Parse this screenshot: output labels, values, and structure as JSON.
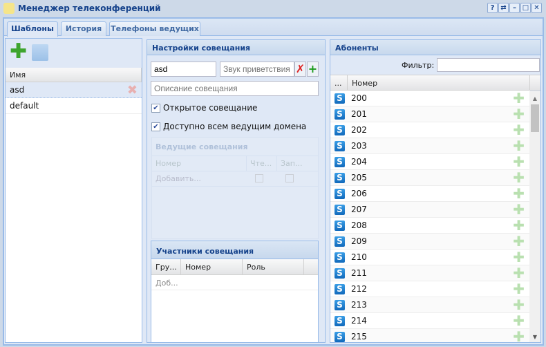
{
  "window": {
    "title": "Менеджер телеконференций",
    "buttons": [
      "?",
      "⇄",
      "–",
      "□",
      "✕"
    ]
  },
  "tabs": [
    {
      "label": "Шаблоны",
      "active": true
    },
    {
      "label": "История"
    },
    {
      "label": "Телефоны ведущих"
    }
  ],
  "templates": {
    "column": "Имя",
    "rows": [
      {
        "name": "asd",
        "selected": true
      },
      {
        "name": "default"
      }
    ]
  },
  "settings": {
    "title": "Настройки совещания",
    "name_value": "asd",
    "sound_placeholder": "Звук приветствия",
    "description_placeholder": "Описание совещания",
    "open_label": "Открытое совещание",
    "open_checked": true,
    "domain_label": "Доступно всем ведущим домена",
    "domain_checked": true
  },
  "hosts": {
    "title": "Ведущие совещания",
    "columns": [
      "Номер",
      "Чте...",
      "Зап..."
    ],
    "add_label": "Добавить..."
  },
  "participants": {
    "title": "Участники совещания",
    "columns": [
      "Гру...",
      "Номер",
      "Роль"
    ],
    "add_label": "Доб..."
  },
  "subscribers": {
    "title": "Абоненты",
    "filter_label": "Фильтр:",
    "filter_value": "",
    "columns": [
      "...",
      "Номер"
    ],
    "rows": [
      "200",
      "201",
      "202",
      "203",
      "204",
      "205",
      "206",
      "207",
      "208",
      "209",
      "210",
      "211",
      "212",
      "213",
      "214",
      "215"
    ]
  }
}
